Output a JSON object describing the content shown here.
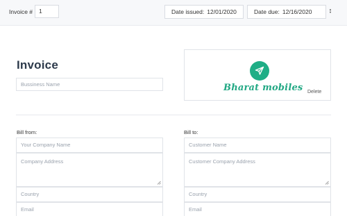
{
  "topbar": {
    "invoice_number_label": "Invoice #",
    "invoice_number_value": "1",
    "date_issued_label": "Date issued:",
    "date_issued_value": "12/01/2020",
    "date_due_label": "Date due:",
    "date_due_value": "12/16/2020"
  },
  "header": {
    "title": "Invoice",
    "business_name_placeholder": "Bussiness Name"
  },
  "logo": {
    "brand_text": "Bharat mobiles",
    "delete_label": "Delete",
    "icon": "paper-plane-icon",
    "color": "#1fae86"
  },
  "bill_from": {
    "label": "Bill from:",
    "name_placeholder": "Your Company Name",
    "address_placeholder": "Company Address",
    "country_placeholder": "Country",
    "email_placeholder": "Email"
  },
  "bill_to": {
    "label": "Bill to:",
    "name_placeholder": "Customer Name",
    "address_placeholder": "Customer Company Address",
    "country_placeholder": "Country",
    "email_placeholder": "Email"
  }
}
